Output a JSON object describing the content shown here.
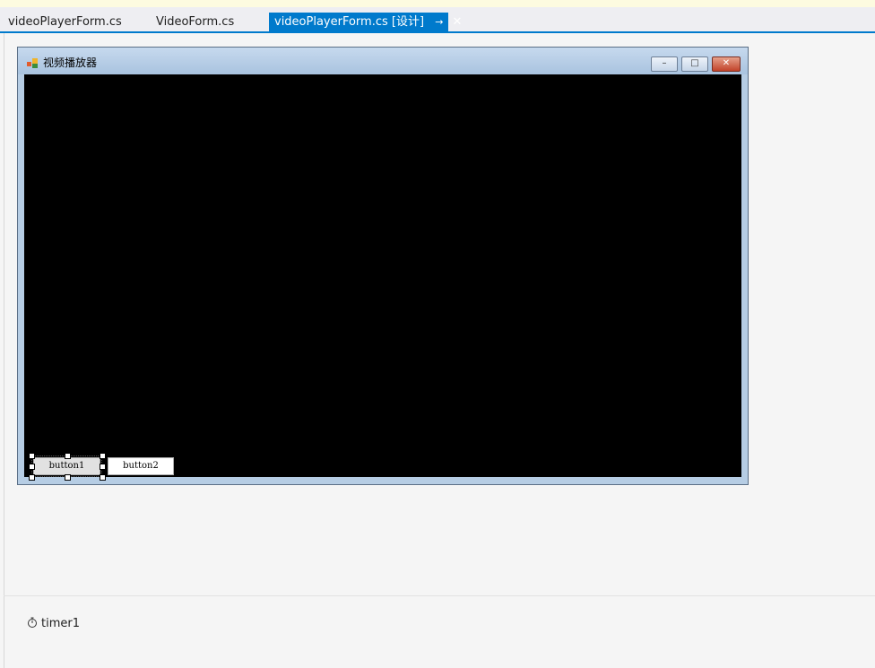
{
  "tabs": [
    {
      "label": "videoPlayerForm.cs",
      "active": false
    },
    {
      "label": "VideoForm.cs",
      "active": false
    },
    {
      "label": "videoPlayerForm.cs [设计]",
      "active": true
    }
  ],
  "active_tab_icons": {
    "pin": "pin-icon",
    "close": "close-icon"
  },
  "form": {
    "title": "视频播放器",
    "icon": "form-app-icon",
    "caption_buttons": {
      "minimize": "minimize-icon",
      "maximize": "maximize-icon",
      "close": "close-icon"
    },
    "client_background": "#000000",
    "buttons": [
      {
        "label": "button1",
        "selected": true
      },
      {
        "label": "button2",
        "selected": false
      }
    ]
  },
  "component_tray": {
    "items": [
      {
        "label": "timer1",
        "icon": "stopwatch-icon"
      }
    ]
  },
  "colors": {
    "accent": "#007acc",
    "designer_bg": "#f5f5f5"
  }
}
